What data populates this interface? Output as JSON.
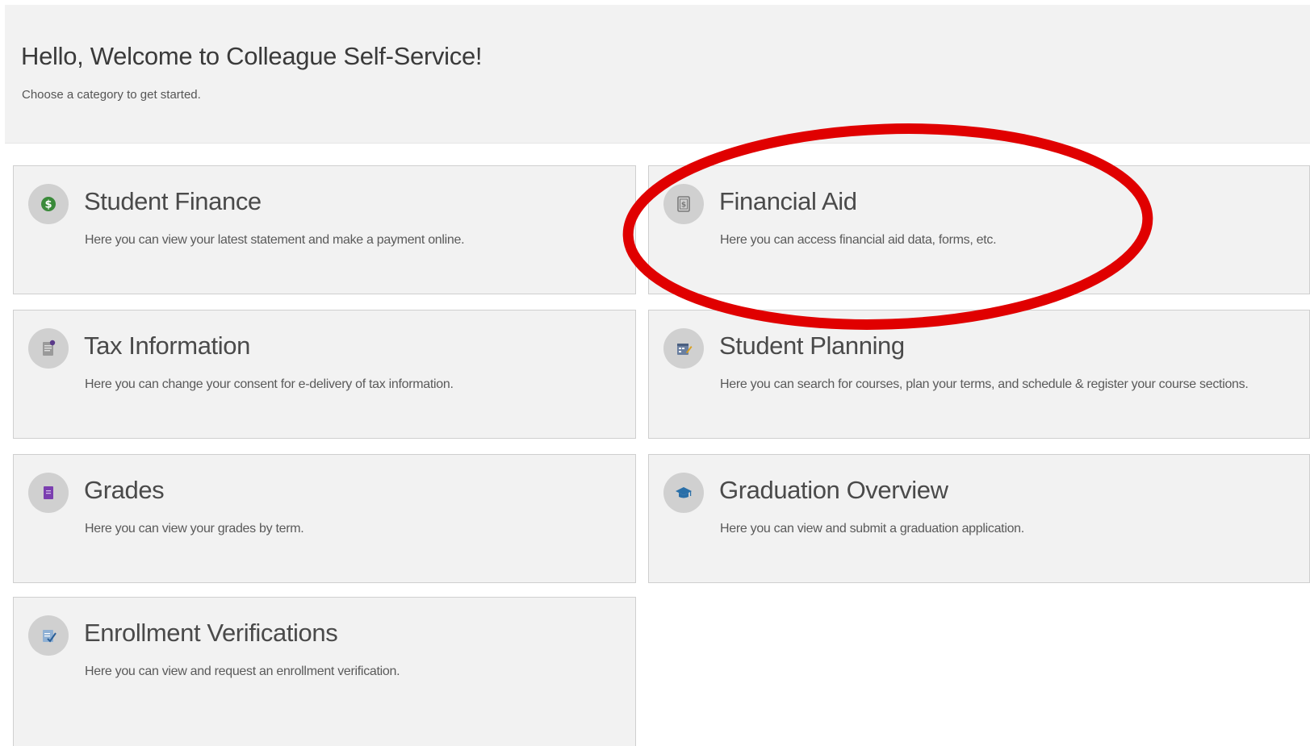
{
  "header": {
    "title": "Hello, Welcome to Colleague Self-Service!",
    "subtitle": "Choose a category to get started."
  },
  "cards": [
    {
      "title": "Student Finance",
      "description": "Here you can view your latest statement and make a payment online.",
      "icon": "dollar-coin-icon",
      "icon_color": "#3a8a3a"
    },
    {
      "title": "Financial Aid",
      "description": "Here you can access financial aid data, forms, etc.",
      "icon": "financial-aid-document-icon",
      "icon_color": "#7a7a7a"
    },
    {
      "title": "Tax Information",
      "description": "Here you can change your consent for e-delivery of tax information.",
      "icon": "tax-document-icon",
      "icon_color": "#8a8a8a"
    },
    {
      "title": "Student Planning",
      "description": "Here you can search for courses, plan your terms, and schedule & register your course sections.",
      "icon": "planner-icon",
      "icon_color": "#6a7fa0"
    },
    {
      "title": "Grades",
      "description": "Here you can view your grades by term.",
      "icon": "grades-book-icon",
      "icon_color": "#7b3fb0"
    },
    {
      "title": "Graduation Overview",
      "description": "Here you can view and submit a graduation application.",
      "icon": "graduation-cap-icon",
      "icon_color": "#2a6fa8"
    },
    {
      "title": "Enrollment Verifications",
      "description": "Here you can view and request an enrollment verification.",
      "icon": "verification-checklist-icon",
      "icon_color": "#6a8fb8"
    }
  ],
  "annotation": {
    "highlight_color": "#e00000"
  }
}
